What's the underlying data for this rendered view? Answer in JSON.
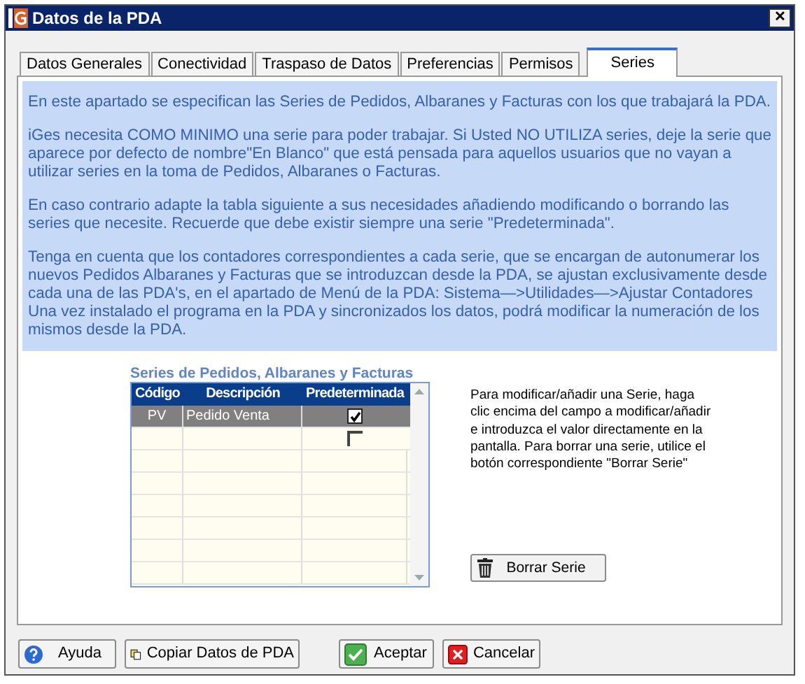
{
  "window": {
    "title": "Datos de la PDA",
    "close": "✕"
  },
  "tabs": [
    {
      "label": "Datos Generales",
      "selected": false
    },
    {
      "label": "Conectividad",
      "selected": false
    },
    {
      "label": "Traspaso de Datos",
      "selected": false
    },
    {
      "label": "Preferencias",
      "selected": false
    },
    {
      "label": "Permisos",
      "selected": false
    },
    {
      "label": "Series",
      "selected": true
    }
  ],
  "info_paragraphs": [
    "En este apartado se especifican las Series de Pedidos, Albaranes y Facturas con los que trabajará la PDA.",
    "iGes necesita COMO MINIMO una serie para poder trabajar. Si Usted NO UTILIZA series, deje la serie que aparece por defecto de nombre\"En Blanco\" que está pensada para aquellos usuarios que no vayan a utilizar series en la toma de Pedidos, Albaranes o Facturas.",
    "En caso contrario adapte la tabla siguiente a sus necesidades añadiendo modificando o borrando las series que necesite. Recuerde que debe existir siempre una serie \"Predeterminada\".",
    "Tenga en cuenta que los contadores correspondientes a cada serie, que se encargan de autonumerar los nuevos Pedidos Albaranes y Facturas que se introduzcan desde la PDA, se ajustan exclusivamente desde cada una de las PDA's, en el apartado de Menú de la PDA: Sistema—>Utilidades—>Ajustar Contadores Una vez instalado el programa en la PDA y sincronizados los datos, podrá modificar la numeración de los mismos desde la PDA."
  ],
  "table": {
    "title": "Series de Pedidos, Albaranes y Facturas",
    "columns": [
      "Código",
      "Descripción",
      "Predeterminada"
    ],
    "rows": [
      {
        "code": "PV",
        "description": "Pedido Venta",
        "checked": true,
        "selected": true
      },
      {
        "code": "",
        "description": "",
        "checked": false,
        "selected": false
      }
    ]
  },
  "help_text": "Para modificar/añadir una Serie, haga clic encima del campo a modificar/añadir e introduzca el valor directamente en la pantalla. Para borrar una serie,  utilice el botón correspondiente \"Borrar Serie\"",
  "delete_button": "Borrar Serie",
  "buttons": [
    {
      "kind": "help",
      "label": "Ayuda"
    },
    {
      "kind": "copy",
      "label": "Copiar Datos de PDA"
    },
    {
      "kind": "accept",
      "label": "Aceptar"
    },
    {
      "kind": "cancel",
      "label": "Cancelar"
    }
  ]
}
